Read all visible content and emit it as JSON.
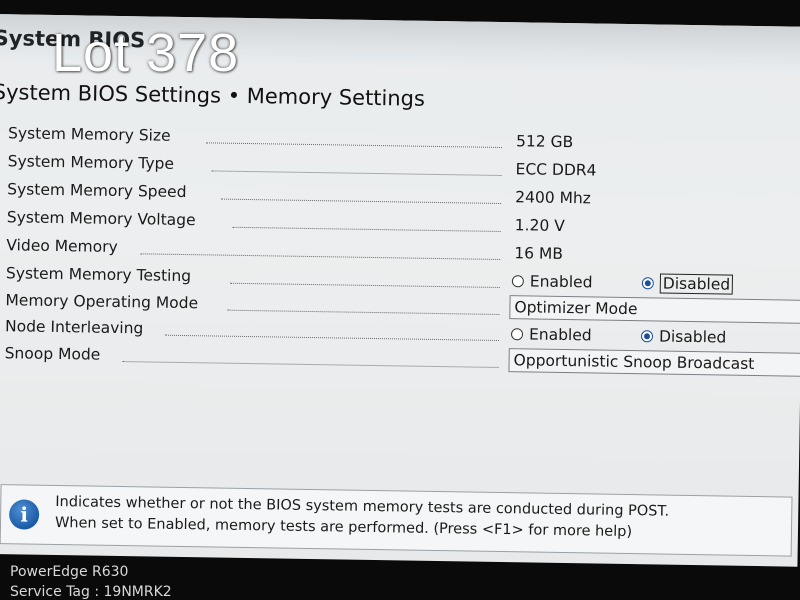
{
  "window": {
    "app_title": "System BIOS",
    "page_heading": "System BIOS Settings • Memory Settings"
  },
  "settings": {
    "system_memory_size": {
      "label": "System Memory Size",
      "value": "512 GB"
    },
    "system_memory_type": {
      "label": "System Memory Type",
      "value": "ECC DDR4"
    },
    "system_memory_speed": {
      "label": "System Memory Speed",
      "value": "2400 Mhz"
    },
    "system_memory_voltage": {
      "label": "System Memory Voltage",
      "value": "1.20 V"
    },
    "video_memory": {
      "label": "Video Memory",
      "value": "16 MB"
    },
    "system_memory_testing": {
      "label": "System Memory Testing",
      "options": [
        "Enabled",
        "Disabled"
      ],
      "selected": "Disabled"
    },
    "memory_operating_mode": {
      "label": "Memory Operating Mode",
      "value": "Optimizer Mode"
    },
    "node_interleaving": {
      "label": "Node Interleaving",
      "options": [
        "Enabled",
        "Disabled"
      ],
      "selected": "Disabled"
    },
    "snoop_mode": {
      "label": "Snoop Mode",
      "value": "Opportunistic Snoop Broadcast"
    }
  },
  "help": {
    "icon": "info-icon",
    "icon_glyph": "i",
    "line1": "Indicates whether or not the BIOS system memory tests are conducted during POST.",
    "line2": "When set to Enabled, memory tests are performed. (Press <F1> for more help)"
  },
  "footer": {
    "model": "PowerEdge R630",
    "service_tag": "Service Tag : 19NMRK2"
  },
  "watermark": {
    "text": "Lot 378"
  },
  "colors": {
    "accent": "#1d4f9a",
    "panel_bg": "#eceeef",
    "bezel": "#0a0a0a"
  }
}
